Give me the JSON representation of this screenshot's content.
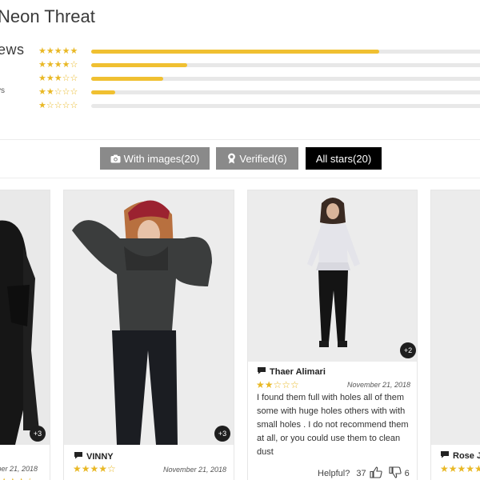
{
  "product": {
    "title": "Neon Threat"
  },
  "summary": {
    "heading": "ews",
    "subtext": "vs",
    "star_color": "#e9b825",
    "bar_color": "#f0c031",
    "distribution": [
      {
        "stars_label": "★★★★★",
        "fraction": 0.72
      },
      {
        "stars_label": "★★★★☆",
        "fraction": 0.24
      },
      {
        "stars_label": "★★★☆☆",
        "fraction": 0.18
      },
      {
        "stars_label": "★★☆☆☆",
        "fraction": 0.06
      },
      {
        "stars_label": "★☆☆☆☆",
        "fraction": 0.0
      }
    ]
  },
  "filters": {
    "with_images": "With images(20)",
    "verified": "Verified(6)",
    "all_stars": "All stars(20)"
  },
  "cards": [
    {
      "badge": "+3",
      "date": "mber 21, 2018",
      "stars": "★★★★☆"
    },
    {
      "badge": "+3",
      "reviewer": "VINNY",
      "date": "November 21, 2018",
      "stars": "★★★★☆"
    },
    {
      "badge": "+2",
      "reviewer": "Thaer Alimari",
      "date": "November 21, 2018",
      "stars": "★★☆☆☆",
      "text": "I found them full with holes all of them some with huge holes others with with small holes . I do not recommend them at all, or you could use them to clean dust",
      "helpful_label": "Helpful?",
      "likes": "37",
      "dislikes": "6"
    },
    {
      "reviewer": "Rose J",
      "stars": "★★★★★"
    }
  ]
}
